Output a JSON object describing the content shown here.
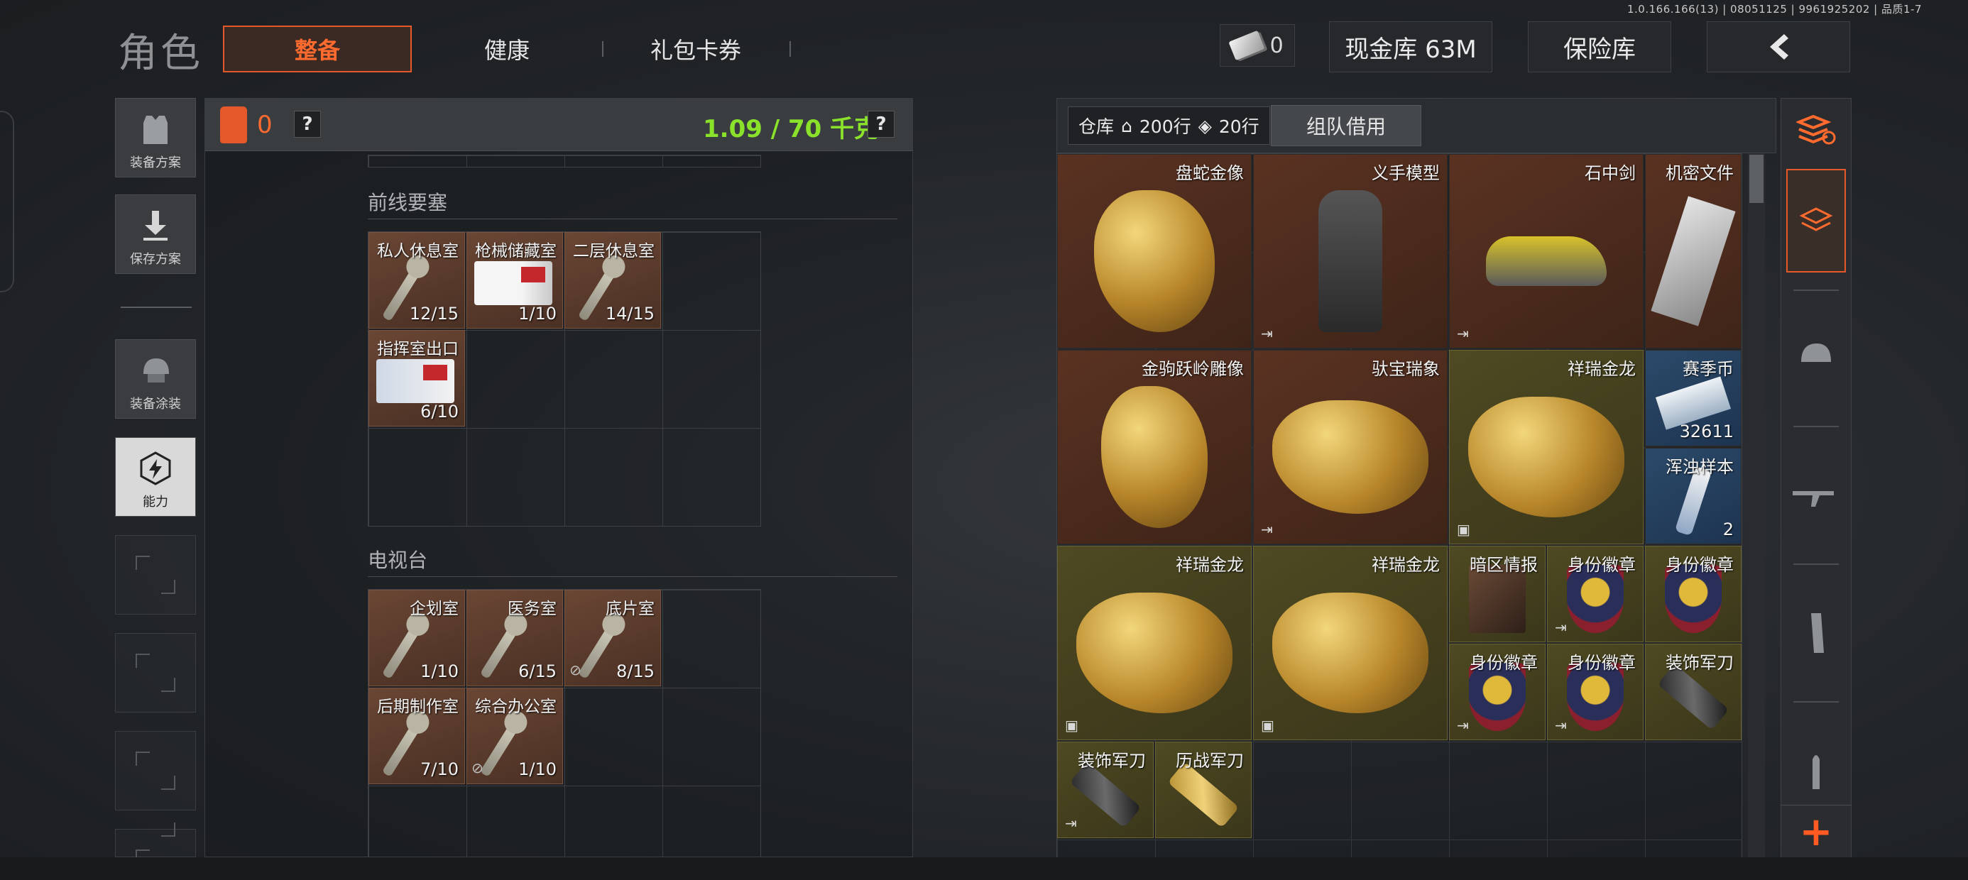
{
  "version": "1.0.166.166(13) | 08051125 | 9961925202 | 品质1-7",
  "header": {
    "role_title": "角色",
    "tabs": [
      {
        "label": "整备",
        "active": true
      },
      {
        "label": "健康",
        "active": false
      },
      {
        "label": "礼包卡券",
        "active": false
      }
    ],
    "ticket_count": "0",
    "cash_button": "现金库 63M",
    "insurance_button": "保险库",
    "back_icon": "chevron-left-icon"
  },
  "sidebar": {
    "items": [
      {
        "label": "装备方案",
        "icon": "vest-icon"
      },
      {
        "label": "保存方案",
        "icon": "download-icon"
      },
      {
        "label": "装备涂装",
        "icon": "helmet-paint-icon"
      },
      {
        "label": "能力",
        "icon": "ability-icon",
        "selected": true
      }
    ]
  },
  "loadout": {
    "bag_count": "0",
    "help": "?",
    "weight": "1.09 / 70 千克",
    "sections": [
      {
        "title": "前线要塞",
        "keys": [
          {
            "name": "私人休息室",
            "count": "12/15",
            "type": "key"
          },
          {
            "name": "枪械储藏室",
            "count": "1/10",
            "type": "card"
          },
          {
            "name": "二层休息室",
            "count": "14/15",
            "type": "key"
          },
          {
            "name": "指挥室出口",
            "count": "6/10",
            "type": "card"
          }
        ]
      },
      {
        "title": "电视台",
        "keys": [
          {
            "name": "企划室",
            "count": "1/10",
            "type": "key"
          },
          {
            "name": "医务室",
            "count": "6/15",
            "type": "key"
          },
          {
            "name": "底片室",
            "count": "8/15",
            "type": "key",
            "restricted": true
          },
          {
            "name": "后期制作室",
            "count": "7/10",
            "type": "key"
          },
          {
            "name": "综合办公室",
            "count": "1/10",
            "type": "key",
            "restricted": true
          }
        ]
      }
    ]
  },
  "warehouse": {
    "label": "仓库",
    "rows_home": "200行",
    "rows_ticket": "20行",
    "borrow_button": "组队借用",
    "items": [
      {
        "name": "盘蛇金像",
        "color": "brown",
        "exit": false
      },
      {
        "name": "义手模型",
        "color": "brown",
        "exit": true
      },
      {
        "name": "石中剑",
        "color": "brown",
        "exit": true
      },
      {
        "name": "机密文件",
        "color": "brown",
        "exit": false
      },
      {
        "name": "金驹跃岭雕像",
        "color": "brown",
        "exit": false
      },
      {
        "name": "驮宝瑞象",
        "color": "brown",
        "exit": true
      },
      {
        "name": "祥瑞金龙",
        "color": "gold",
        "exit": false
      },
      {
        "name": "赛季币",
        "count": "32611",
        "color": "blue"
      },
      {
        "name": "浑浊样本",
        "count": "2",
        "color": "blue"
      },
      {
        "name": "祥瑞金龙",
        "color": "gold"
      },
      {
        "name": "祥瑞金龙",
        "color": "gold"
      },
      {
        "name": "暗区情报",
        "color": "gold"
      },
      {
        "name": "身份徽章",
        "color": "gold",
        "exit": true
      },
      {
        "name": "身份徽章",
        "color": "gold"
      },
      {
        "name": "身份徽章",
        "color": "gold",
        "exit": true
      },
      {
        "name": "身份徽章",
        "color": "gold",
        "exit": true
      },
      {
        "name": "装饰军刀",
        "color": "gold"
      },
      {
        "name": "装饰军刀",
        "color": "gold",
        "exit": true
      },
      {
        "name": "历战军刀",
        "color": "gold"
      }
    ]
  },
  "right_toolbar": {
    "icons": [
      "stack-sort-icon",
      "layers-icon",
      "helmet-icon",
      "rifle-icon",
      "magazine-icon",
      "ammo-icon"
    ],
    "add": "+"
  },
  "colors": {
    "accent": "#e4582a",
    "weight_green": "#8be22a",
    "brown_item": "#4a2a1c",
    "gold_item": "#4a4520"
  }
}
